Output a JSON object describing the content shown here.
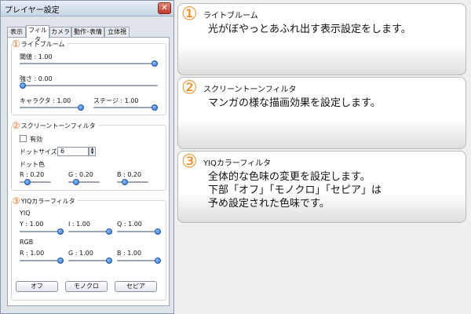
{
  "window": {
    "title": "プレイヤー設定",
    "close_glyph": "✕"
  },
  "tabs": [
    "表示",
    "フィルタ",
    "カメラ",
    "動作･表情",
    "立体視"
  ],
  "active_tab": 1,
  "bloom": {
    "number": "①",
    "title": "ライトブルーム",
    "threshold": {
      "label": "閾値 : 1.00",
      "value": 1.0,
      "min": 0,
      "max": 1
    },
    "strength": {
      "label": "強さ : 0.00",
      "value": 0.0,
      "min": 0,
      "max": 1
    },
    "character": {
      "label": "キャラクタ : 1.00",
      "value": 1.0,
      "min": 0,
      "max": 1
    },
    "stage": {
      "label": "ステージ : 1.00",
      "value": 1.0,
      "min": 0,
      "max": 1
    }
  },
  "screentone": {
    "number": "②",
    "title": "スクリーントーンフィルタ",
    "enabled_label": "有効",
    "enabled": false,
    "dot_size_label": "ドットサイズ",
    "dot_size_value": "6",
    "dot_color_label": "ドット色",
    "r": {
      "label": "R : 0.20",
      "value": 0.2,
      "min": 0,
      "max": 1
    },
    "g": {
      "label": "G : 0.20",
      "value": 0.2,
      "min": 0,
      "max": 1
    },
    "b": {
      "label": "B : 0.20",
      "value": 0.2,
      "min": 0,
      "max": 1
    }
  },
  "yiq": {
    "number": "③",
    "title": "YIQカラーフィルタ",
    "yiq_label": "YIQ",
    "y": {
      "label": "Y : 1.00",
      "value": 1.0,
      "min": 0,
      "max": 1
    },
    "i": {
      "label": "I : 1.00",
      "value": 1.0,
      "min": 0,
      "max": 1
    },
    "q": {
      "label": "Q : 1.00",
      "value": 1.0,
      "min": 0,
      "max": 1
    },
    "rgb_label": "RGB",
    "r": {
      "label": "R : 1.00",
      "value": 1.0,
      "min": 0,
      "max": 1
    },
    "g": {
      "label": "G : 1.00",
      "value": 1.0,
      "min": 0,
      "max": 1
    },
    "b": {
      "label": "B : 1.00",
      "value": 1.0,
      "min": 0,
      "max": 1
    },
    "buttons": {
      "off": "オフ",
      "mono": "モノクロ",
      "sepia": "セピア"
    }
  },
  "cards": [
    {
      "number": "①",
      "title": "ライトブルーム",
      "lines": [
        "光がぼやっとあふれ出す表示設定をします。"
      ]
    },
    {
      "number": "②",
      "title": "スクリーントーンフィルタ",
      "lines": [
        "マンガの様な描画効果を設定します。"
      ]
    },
    {
      "number": "③",
      "title": "YIQカラーフィルタ",
      "lines": [
        "全体的な色味の変更を設定します。",
        "下部「オフ」「モノクロ」「セピア」は",
        "予め設定された色味です。"
      ]
    }
  ],
  "colors": {
    "accent_number": "#f08a1c",
    "slider_thumb": "#2f6fd6"
  }
}
